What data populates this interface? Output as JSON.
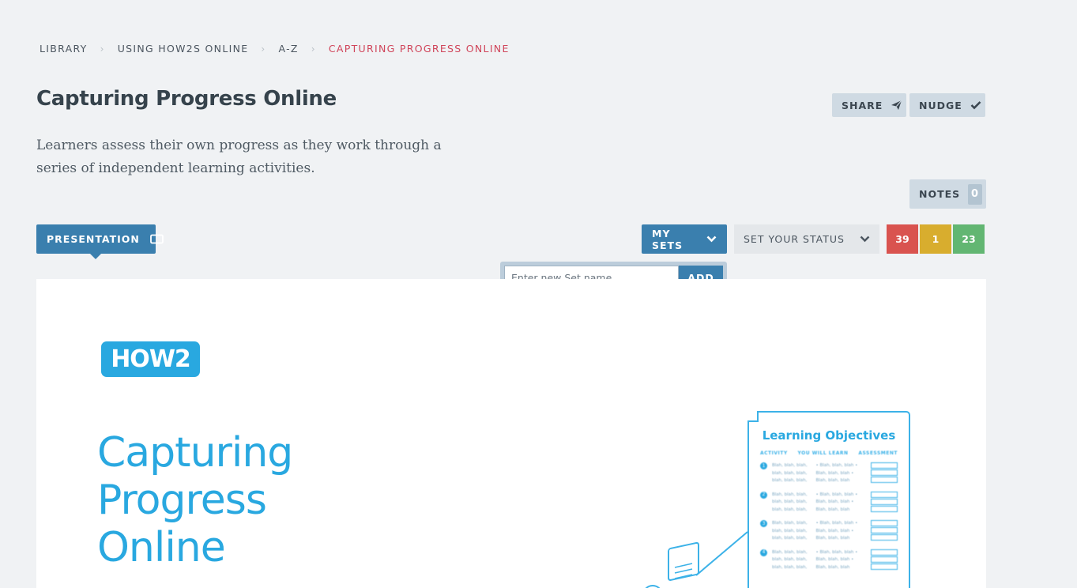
{
  "breadcrumb": {
    "items": [
      "LIBRARY",
      "USING HOW2S ONLINE",
      "A-Z",
      "CAPTURING PROGRESS ONLINE"
    ],
    "separator": "›"
  },
  "header": {
    "title": "Capturing Progress Online",
    "description": "Learners assess their own progress as they work through a series of independent learning activities."
  },
  "actions": {
    "share_label": "SHARE",
    "nudge_label": "NUDGE",
    "notes_label": "NOTES",
    "notes_count": "0"
  },
  "toolbar": {
    "presentation_label": "PRESENTATION",
    "my_sets_label": "MY SETS",
    "status_label": "SET YOUR STATUS",
    "counts": {
      "red": "39",
      "yellow": "1",
      "green": "23"
    }
  },
  "new_set": {
    "placeholder": "Enter new Set name...",
    "value": "",
    "add_label": "ADD"
  },
  "slide": {
    "logo_text": "HOW2",
    "title_lines": [
      "Capturing",
      "Progress",
      "Online"
    ],
    "doc_title": "Learning Objectives",
    "doc_columns": [
      "ACTIVITY",
      "YOU WILL LEARN",
      "ASSESSMENT"
    ],
    "doc_rows": [
      {
        "num": "1",
        "activity": "Blah, blah, blah, blah, blah, blah, blah, blah, blah,",
        "learn": "• Blah, blah, blah • Blah, blah, blah • Blah, blah, blah"
      },
      {
        "num": "2",
        "activity": "Blah, blah, blah, blah, blah, blah, blah, blah, blah,",
        "learn": "• Blah, blah, blah • Blah, blah, blah • Blah, blah, blah"
      },
      {
        "num": "3",
        "activity": "Blah, blah, blah, blah, blah, blah, blah, blah, blah,",
        "learn": "• Blah, blah, blah • Blah, blah, blah • Blah, blah, blah"
      },
      {
        "num": "4",
        "activity": "Blah, blah, blah, blah, blah, blah, blah, blah, blah,",
        "learn": "• Blah, blah, blah • Blah, blah, blah • Blah, blah, blah"
      }
    ]
  },
  "colors": {
    "accent_blue": "#3a7fae",
    "brand_cyan": "#29a8e0",
    "current_crumb": "#d0455a",
    "count_red": "#d9534f",
    "count_yellow": "#d8ad2e",
    "count_green": "#62b672"
  },
  "icons": {
    "share": "paper-plane-icon",
    "nudge": "check-icon",
    "presentation": "screen-icon",
    "my_sets": "chevron-down-icon",
    "status": "chevron-down-icon",
    "breadcrumb_separator": "chevron-right-icon"
  }
}
